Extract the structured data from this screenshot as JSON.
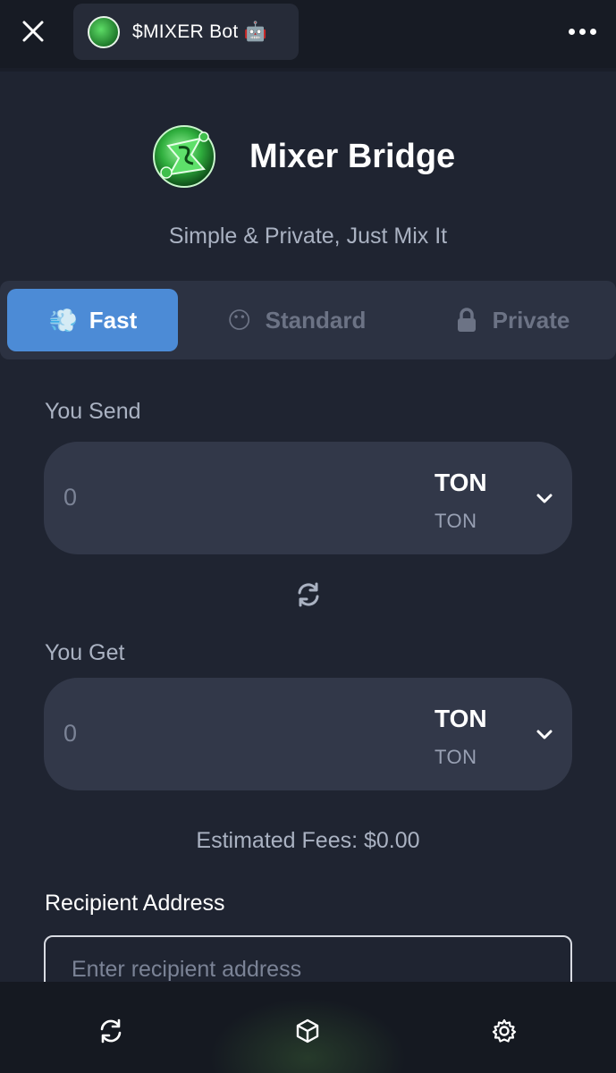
{
  "topbar": {
    "bot_title": "$MIXER Bot 🤖",
    "close_icon": "close-icon",
    "more_icon": "more-dots-icon"
  },
  "brand": {
    "name": "Mixer Bridge",
    "tagline": "Simple & Private, Just Mix It",
    "logo_icon": "mixer-logo-icon"
  },
  "tabs": [
    {
      "label": "Fast",
      "icon": "💨",
      "active": true
    },
    {
      "label": "Standard",
      "icon": "😶",
      "active": false
    },
    {
      "label": "Private",
      "icon": "lock-icon",
      "active": false
    }
  ],
  "send": {
    "label": "You Send",
    "placeholder": "0",
    "token_symbol": "TON",
    "token_network": "TON"
  },
  "get": {
    "label": "You Get",
    "placeholder": "0",
    "token_symbol": "TON",
    "token_network": "TON"
  },
  "swap_icon": "swap-refresh-icon",
  "fees": "Estimated Fees: $0.00",
  "recipient": {
    "label": "Recipient Address",
    "placeholder": "Enter recipient address"
  },
  "bottom_nav": [
    {
      "icon": "refresh-icon"
    },
    {
      "icon": "cube-icon"
    },
    {
      "icon": "gear-icon"
    }
  ],
  "colors": {
    "accent": "#4c8bd6",
    "background": "#1f2431",
    "field": "#323849"
  }
}
